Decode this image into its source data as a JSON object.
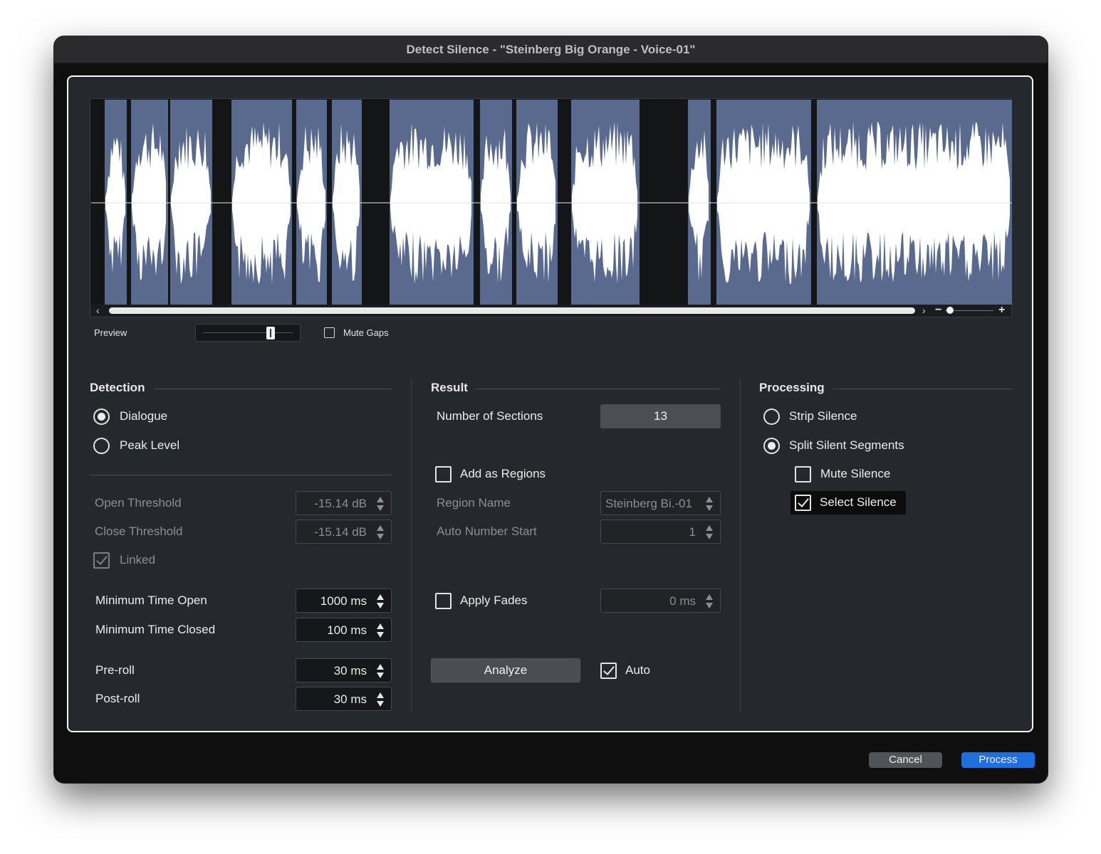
{
  "window": {
    "title": "Detect Silence - \"Steinberg Big Orange - Voice-01\""
  },
  "waveform": {
    "icons": {
      "scroll_left": "chevron-left-icon",
      "scroll_right": "chevron-right-icon",
      "zoom_out": "minus-icon",
      "zoom_in": "plus-icon"
    },
    "colors": {
      "kept_region": "#5a6a8e",
      "silent_gap": "#141517",
      "waveform": "#ffffff"
    }
  },
  "preview": {
    "label": "Preview",
    "mute_gaps_label": "Mute Gaps",
    "mute_gaps_checked": false
  },
  "detection": {
    "title": "Detection",
    "modes": [
      {
        "label": "Dialogue",
        "selected": true
      },
      {
        "label": "Peak Level",
        "selected": false
      }
    ],
    "open_threshold": {
      "label": "Open Threshold",
      "value": "-15.14 dB"
    },
    "close_threshold": {
      "label": "Close Threshold",
      "value": "-15.14 dB"
    },
    "linked": {
      "label": "Linked",
      "checked": true
    },
    "min_time_open": {
      "label": "Minimum Time Open",
      "value": "1000 ms"
    },
    "min_time_closed": {
      "label": "Minimum Time Closed",
      "value": "100 ms"
    },
    "pre_roll": {
      "label": "Pre-roll",
      "value": "30 ms"
    },
    "post_roll": {
      "label": "Post-roll",
      "value": "30 ms"
    }
  },
  "result": {
    "title": "Result",
    "sections": {
      "label": "Number of Sections",
      "value": "13"
    },
    "add_as_regions": {
      "label": "Add as Regions",
      "checked": false
    },
    "region_name": {
      "label": "Region Name",
      "value": "Steinberg Bi.-01"
    },
    "auto_number_start": {
      "label": "Auto Number Start",
      "value": "1"
    },
    "apply_fades": {
      "label": "Apply Fades",
      "checked": false,
      "value": "0 ms"
    },
    "analyze_label": "Analyze",
    "auto": {
      "label": "Auto",
      "checked": true
    }
  },
  "processing": {
    "title": "Processing",
    "modes": [
      {
        "label": "Strip Silence",
        "selected": false
      },
      {
        "label": "Split Silent Segments",
        "selected": true
      }
    ],
    "mute_silence": {
      "label": "Mute Silence",
      "checked": false
    },
    "select_silence": {
      "label": "Select Silence",
      "checked": true
    }
  },
  "footer": {
    "cancel_label": "Cancel",
    "process_label": "Process",
    "accent": "#1f6fe0"
  }
}
